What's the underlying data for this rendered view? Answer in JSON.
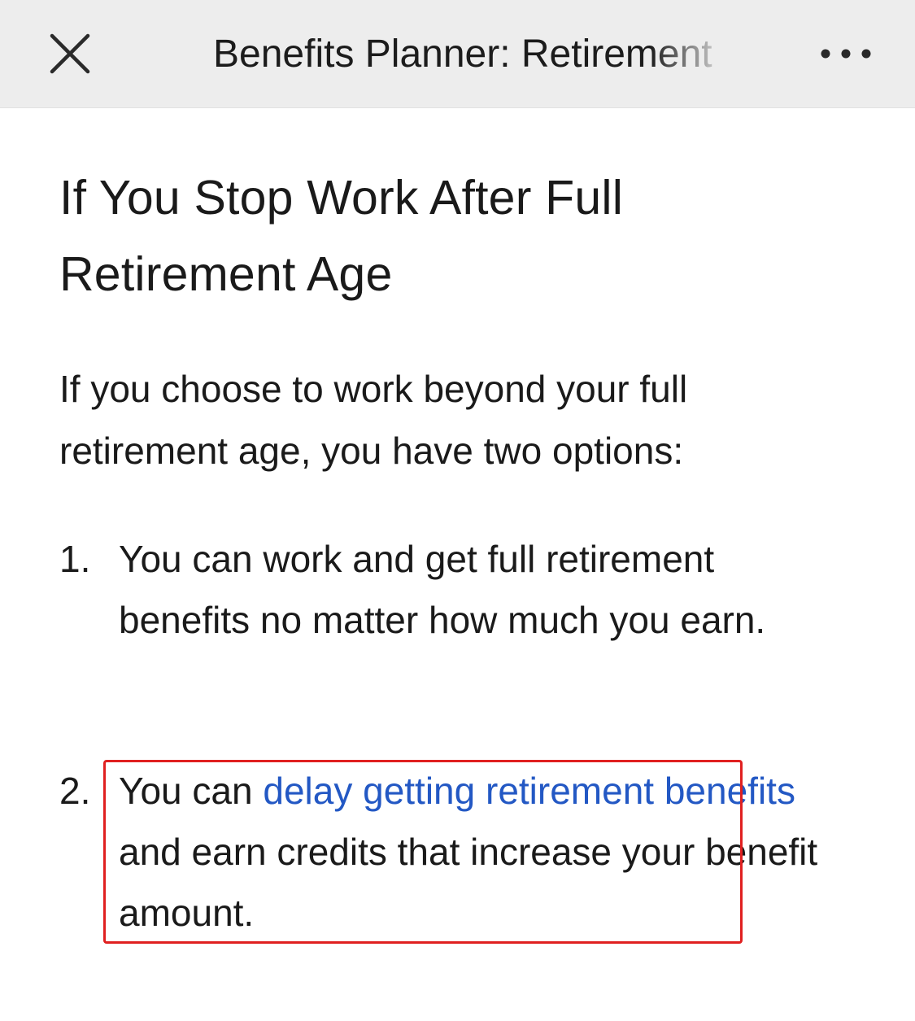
{
  "header": {
    "title": "Benefits Planner: Retirement",
    "close_icon": "close-icon",
    "more_icon": "more-horizontal-icon"
  },
  "article": {
    "heading": "If You Stop Work After Full Retirement Age",
    "intro": "If you choose to work beyond your full retirement age, you have two options:",
    "options": [
      {
        "number": "1.",
        "text": "You can work and get full retirement benefits no matter how much you earn."
      },
      {
        "number": "2.",
        "text_before": "You can ",
        "link_text": "delay getting retirement benefits",
        "text_after": " and earn credits that increase your benefit amount."
      }
    ]
  },
  "colors": {
    "link": "#2358c4",
    "highlight_border": "#e02020",
    "topbar_bg": "#ededed"
  }
}
